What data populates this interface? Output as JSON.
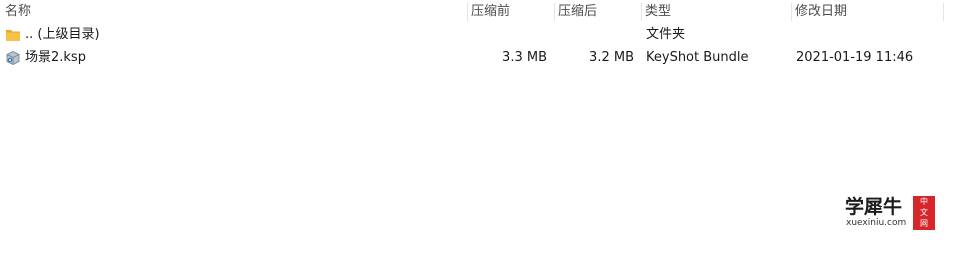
{
  "columns": {
    "name": "名称",
    "compressed": "压缩前",
    "original": "压缩后",
    "type": "类型",
    "modified": "修改日期"
  },
  "rows": [
    {
      "icon": "folder-icon",
      "name": ".. (上级目录)",
      "compressed": "",
      "original": "",
      "type": "文件夹",
      "modified": ""
    },
    {
      "icon": "keyshot-file-icon",
      "name": "场景2.ksp",
      "compressed": "3.3 MB",
      "original": "3.2 MB",
      "type": "KeyShot Bundle",
      "modified": "2021-01-19 11:46"
    }
  ],
  "watermark": {
    "title": "学犀牛",
    "url": "xuexiniu.com",
    "badge": [
      "中",
      "文",
      "网"
    ]
  },
  "colors": {
    "folder": "#f5c343",
    "badge": "#d6262b"
  }
}
